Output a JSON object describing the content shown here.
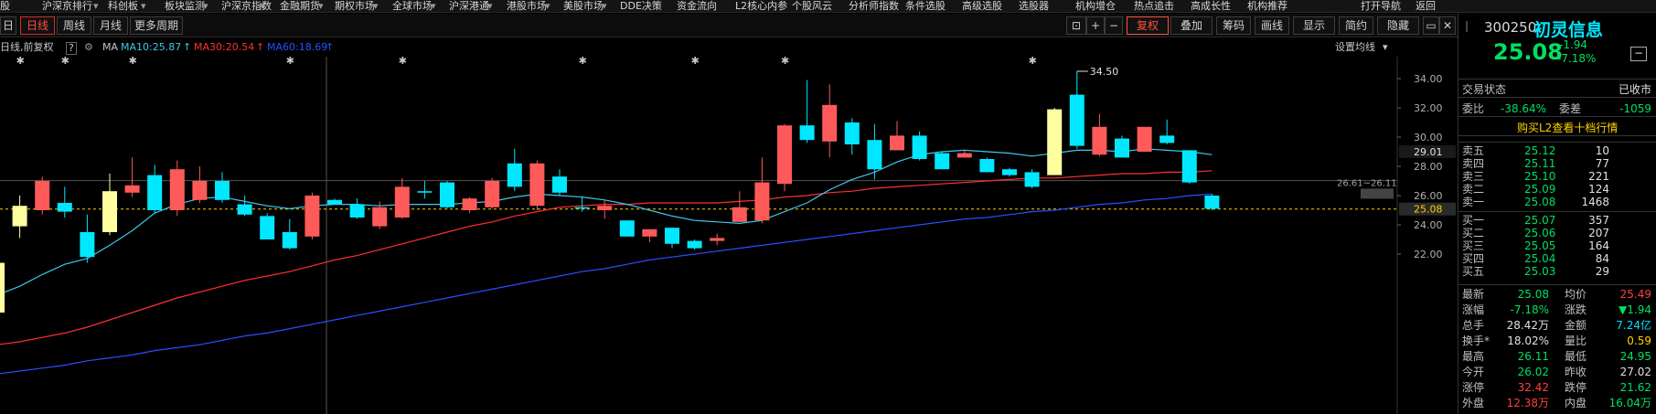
{
  "top_menu": [
    "股",
    "沪深京排行",
    "科创板",
    "板块监测",
    "沪深京指数",
    "金融期货",
    "期权市场",
    "全球市场",
    "沪深港通",
    "港股市场",
    "美股市场",
    "DDE决策",
    "资金流向",
    "L2核心内参",
    "个股风云",
    "分析师指数",
    "条件选股",
    "高级选股",
    "选股器",
    "机构增仓",
    "热点追击",
    "高成长性",
    "机构推荐",
    "打开导航",
    "返回"
  ],
  "toolbar": {
    "tabs": [
      "日",
      "日线",
      "周线",
      "月线",
      "更多周期"
    ],
    "right_buttons": [
      "复权",
      "叠加",
      "筹码",
      "画线",
      "显示",
      "简约",
      "隐藏"
    ]
  },
  "indicator": {
    "label": "日线,前复权",
    "ma_label": "MA",
    "ma10": "MA10:25.87",
    "ma30": "MA30:20.54",
    "ma60": "MA60:18.69",
    "settings": "设置均线"
  },
  "colors": {
    "up": "#ff5a5a",
    "down": "#00e8ff",
    "ma10": "#40c8e8",
    "ma30": "#ff3030",
    "ma60": "#2850ff",
    "yellow": "#ffffa0"
  },
  "chart_data": {
    "type": "candlestick",
    "ylim": [
      21,
      35
    ],
    "y_ticks": [
      "34.00",
      "32.00",
      "30.00",
      "28.00",
      "26.00",
      "24.00",
      "22.00"
    ],
    "price_tags": [
      "29.01",
      "25.08"
    ],
    "high_annotation": "34.50",
    "range_annotation": "26.61~26.11",
    "candles": [
      {
        "o": 21.4,
        "h": 21.5,
        "c": 18.0,
        "l": 18.0,
        "s": "y"
      },
      {
        "o": 23.9,
        "h": 26.0,
        "c": 25.3,
        "l": 23.1,
        "s": "y"
      },
      {
        "o": 25.0,
        "h": 27.3,
        "c": 27.0,
        "l": 24.7,
        "s": "r"
      },
      {
        "o": 25.5,
        "h": 26.6,
        "c": 24.9,
        "l": 24.5,
        "s": "c"
      },
      {
        "o": 23.5,
        "h": 24.7,
        "c": 21.8,
        "l": 21.4,
        "s": "c"
      },
      {
        "o": 23.5,
        "h": 27.5,
        "c": 26.3,
        "l": 23.3,
        "s": "y"
      },
      {
        "o": 26.2,
        "h": 28.6,
        "c": 26.7,
        "l": 25.9,
        "s": "r"
      },
      {
        "o": 27.4,
        "h": 28.1,
        "c": 25.0,
        "l": 24.8,
        "s": "c"
      },
      {
        "o": 25.0,
        "h": 28.4,
        "c": 27.8,
        "l": 24.6,
        "s": "r"
      },
      {
        "o": 27.0,
        "h": 28.0,
        "c": 25.7,
        "l": 25.5,
        "s": "r"
      },
      {
        "o": 27.0,
        "h": 27.6,
        "c": 25.7,
        "l": 25.5,
        "s": "c"
      },
      {
        "o": 25.4,
        "h": 26.0,
        "c": 24.7,
        "l": 24.6,
        "s": "c"
      },
      {
        "o": 24.6,
        "h": 24.8,
        "c": 23.0,
        "l": 23.0,
        "s": "c"
      },
      {
        "o": 23.5,
        "h": 24.4,
        "c": 22.4,
        "l": 22.3,
        "s": "c"
      },
      {
        "o": 23.2,
        "h": 26.2,
        "c": 26.0,
        "l": 23.0,
        "s": "r"
      },
      {
        "o": 25.7,
        "h": 25.8,
        "c": 25.4,
        "l": 25.4,
        "s": "c"
      },
      {
        "o": 25.4,
        "h": 25.8,
        "c": 24.5,
        "l": 24.4,
        "s": "c"
      },
      {
        "o": 23.9,
        "h": 25.6,
        "c": 25.2,
        "l": 23.7,
        "s": "r"
      },
      {
        "o": 24.5,
        "h": 27.2,
        "c": 26.6,
        "l": 24.4,
        "s": "r"
      },
      {
        "o": 26.3,
        "h": 27.0,
        "c": 26.2,
        "l": 25.8,
        "s": "c"
      },
      {
        "o": 26.9,
        "h": 27.0,
        "c": 25.2,
        "l": 25.1,
        "s": "c"
      },
      {
        "o": 25.0,
        "h": 25.9,
        "c": 25.8,
        "l": 24.8,
        "s": "r"
      },
      {
        "o": 25.2,
        "h": 27.2,
        "c": 27.0,
        "l": 25.1,
        "s": "r"
      },
      {
        "o": 28.2,
        "h": 29.2,
        "c": 26.6,
        "l": 26.3,
        "s": "c"
      },
      {
        "o": 25.3,
        "h": 28.4,
        "c": 28.2,
        "l": 25.0,
        "s": "r"
      },
      {
        "o": 27.3,
        "h": 27.8,
        "c": 26.2,
        "l": 26.0,
        "s": "c"
      },
      {
        "o": 25.2,
        "h": 25.9,
        "c": 25.2,
        "l": 24.9,
        "s": "c"
      },
      {
        "o": 25.3,
        "h": 25.7,
        "c": 25.0,
        "l": 24.4,
        "s": "r"
      },
      {
        "o": 24.3,
        "h": 24.3,
        "c": 23.2,
        "l": 23.2,
        "s": "c"
      },
      {
        "o": 23.2,
        "h": 23.2,
        "c": 23.7,
        "l": 22.8,
        "s": "r"
      },
      {
        "o": 23.8,
        "h": 23.8,
        "c": 22.7,
        "l": 22.4,
        "s": "c"
      },
      {
        "o": 22.9,
        "h": 23.0,
        "c": 22.4,
        "l": 22.3,
        "s": "c"
      },
      {
        "o": 22.9,
        "h": 23.4,
        "c": 23.1,
        "l": 22.6,
        "s": "r"
      },
      {
        "o": 24.2,
        "h": 26.3,
        "c": 25.2,
        "l": 24.2,
        "s": "r"
      },
      {
        "o": 24.3,
        "h": 28.6,
        "c": 26.9,
        "l": 24.1,
        "s": "r"
      },
      {
        "o": 26.8,
        "h": 30.9,
        "c": 30.8,
        "l": 26.3,
        "s": "r"
      },
      {
        "o": 29.8,
        "h": 33.9,
        "c": 30.8,
        "l": 29.6,
        "s": "c"
      },
      {
        "o": 29.7,
        "h": 33.6,
        "c": 32.2,
        "l": 28.6,
        "s": "r"
      },
      {
        "o": 31.0,
        "h": 31.3,
        "c": 29.5,
        "l": 28.8,
        "s": "c"
      },
      {
        "o": 29.8,
        "h": 30.9,
        "c": 27.8,
        "l": 27.1,
        "s": "c"
      },
      {
        "o": 29.1,
        "h": 31.1,
        "c": 30.1,
        "l": 29.1,
        "s": "r"
      },
      {
        "o": 30.1,
        "h": 30.4,
        "c": 28.5,
        "l": 28.4,
        "s": "c"
      },
      {
        "o": 28.9,
        "h": 29.0,
        "c": 27.8,
        "l": 27.8,
        "s": "c"
      },
      {
        "o": 28.6,
        "h": 29.1,
        "c": 28.9,
        "l": 28.6,
        "s": "r"
      },
      {
        "o": 28.5,
        "h": 28.6,
        "c": 27.6,
        "l": 27.6,
        "s": "c"
      },
      {
        "o": 27.8,
        "h": 27.9,
        "c": 27.4,
        "l": 27.3,
        "s": "c"
      },
      {
        "o": 27.6,
        "h": 27.8,
        "c": 26.6,
        "l": 26.5,
        "s": "c"
      },
      {
        "o": 27.4,
        "h": 32.0,
        "c": 31.9,
        "l": 27.4,
        "s": "y"
      },
      {
        "o": 32.9,
        "h": 34.5,
        "c": 29.4,
        "l": 29.2,
        "s": "c"
      },
      {
        "o": 28.8,
        "h": 31.6,
        "c": 30.7,
        "l": 28.7,
        "s": "r"
      },
      {
        "o": 29.9,
        "h": 30.1,
        "c": 28.6,
        "l": 28.6,
        "s": "c"
      },
      {
        "o": 29.0,
        "h": 30.7,
        "c": 30.7,
        "l": 29.0,
        "s": "r"
      },
      {
        "o": 30.1,
        "h": 31.2,
        "c": 29.6,
        "l": 29.5,
        "s": "c"
      },
      {
        "o": 29.1,
        "h": 29.1,
        "c": 26.9,
        "l": 26.8,
        "s": "c"
      },
      {
        "o": 26.0,
        "h": 26.1,
        "c": 25.1,
        "l": 25.0,
        "s": "c"
      }
    ],
    "ma10": [
      19.2,
      19.8,
      20.6,
      21.3,
      21.7,
      22.6,
      23.6,
      24.8,
      25.4,
      25.8,
      25.9,
      25.6,
      25.3,
      25.1,
      25.3,
      25.4,
      25.4,
      25.3,
      25.4,
      25.4,
      25.4,
      25.5,
      25.6,
      25.9,
      26.1,
      26.0,
      25.9,
      25.7,
      25.4,
      25.0,
      24.6,
      24.3,
      24.2,
      24.1,
      24.3,
      24.9,
      25.5,
      26.4,
      27.1,
      27.6,
      28.3,
      28.8,
      29.0,
      29.1,
      29.0,
      28.9,
      28.7,
      28.9,
      29.1,
      29.1,
      29.0,
      29.2,
      29.1,
      29.0,
      28.8
    ],
    "ma30": [
      15.8,
      16.0,
      16.3,
      16.6,
      17.0,
      17.5,
      18.0,
      18.5,
      19.0,
      19.4,
      19.8,
      20.2,
      20.5,
      20.8,
      21.2,
      21.6,
      21.9,
      22.3,
      22.7,
      23.1,
      23.5,
      23.9,
      24.2,
      24.6,
      24.9,
      25.2,
      25.3,
      25.4,
      25.4,
      25.5,
      25.5,
      25.5,
      25.5,
      25.6,
      25.7,
      25.9,
      26.0,
      26.2,
      26.3,
      26.5,
      26.6,
      26.7,
      26.8,
      26.9,
      27.0,
      27.1,
      27.2,
      27.2,
      27.3,
      27.4,
      27.5,
      27.5,
      27.6,
      27.6,
      27.7
    ],
    "ma60": [
      13.8,
      14.0,
      14.2,
      14.4,
      14.7,
      14.9,
      15.1,
      15.4,
      15.6,
      15.8,
      16.1,
      16.4,
      16.6,
      16.9,
      17.2,
      17.5,
      17.8,
      18.1,
      18.4,
      18.7,
      19.0,
      19.3,
      19.6,
      19.9,
      20.2,
      20.5,
      20.8,
      21.0,
      21.3,
      21.6,
      21.8,
      22.0,
      22.2,
      22.4,
      22.6,
      22.8,
      23.0,
      23.2,
      23.4,
      23.6,
      23.8,
      24.0,
      24.2,
      24.4,
      24.5,
      24.7,
      24.9,
      25.0,
      25.2,
      25.4,
      25.5,
      25.7,
      25.8,
      26.0,
      26.1
    ],
    "markers": [
      1,
      3,
      6,
      13,
      18,
      26,
      31,
      35,
      46
    ]
  },
  "quote": {
    "code": "300250",
    "name": "初灵信息",
    "price": "25.08",
    "change": "-1.94",
    "change_pct": "-7.18%",
    "trade_state_label": "交易状态",
    "trade_state": "已收市",
    "weibi_label": "委比",
    "weibi": "-38.64%",
    "weicha_label": "委差",
    "weicha": "-1059",
    "l2_link": "购买L2查看十档行情",
    "asks": [
      {
        "label": "卖五",
        "price": "25.12",
        "vol": "10"
      },
      {
        "label": "卖四",
        "price": "25.11",
        "vol": "77"
      },
      {
        "label": "卖三",
        "price": "25.10",
        "vol": "221"
      },
      {
        "label": "卖二",
        "price": "25.09",
        "vol": "124"
      },
      {
        "label": "卖一",
        "price": "25.08",
        "vol": "1468"
      }
    ],
    "bids": [
      {
        "label": "买一",
        "price": "25.07",
        "vol": "357"
      },
      {
        "label": "买二",
        "price": "25.06",
        "vol": "207"
      },
      {
        "label": "买三",
        "price": "25.05",
        "vol": "164"
      },
      {
        "label": "买四",
        "price": "25.04",
        "vol": "84"
      },
      {
        "label": "买五",
        "price": "25.03",
        "vol": "29"
      }
    ],
    "stats": [
      {
        "l1": "最新",
        "v1": "25.08",
        "c1": "green",
        "l2": "均价",
        "v2": "25.49",
        "c2": "red"
      },
      {
        "l1": "涨幅",
        "v1": "-7.18%",
        "c1": "green",
        "l2": "涨跌",
        "v2": "▼1.94",
        "c2": "green"
      },
      {
        "l1": "总手",
        "v1": "28.42万",
        "c1": "white",
        "l2": "金额",
        "v2": "7.24亿",
        "c2": "cyan"
      },
      {
        "l1": "换手*",
        "v1": "18.02%",
        "c1": "white",
        "l2": "量比",
        "v2": "0.59",
        "c2": "yellow"
      },
      {
        "l1": "最高",
        "v1": "26.11",
        "c1": "green",
        "l2": "最低",
        "v2": "24.95",
        "c2": "green"
      },
      {
        "l1": "今开",
        "v1": "26.02",
        "c1": "green",
        "l2": "昨收",
        "v2": "27.02",
        "c2": "white"
      },
      {
        "l1": "涨停",
        "v1": "32.42",
        "c1": "red",
        "l2": "跌停",
        "v2": "21.62",
        "c2": "green"
      },
      {
        "l1": "外盘",
        "v1": "12.38万",
        "c1": "red",
        "l2": "内盘",
        "v2": "16.04万",
        "c2": "green"
      }
    ]
  }
}
